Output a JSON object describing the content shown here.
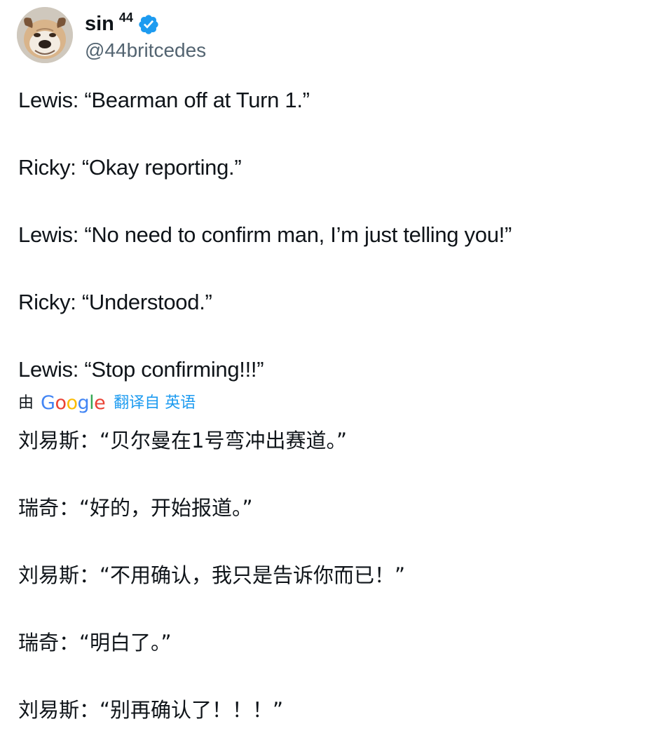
{
  "author": {
    "display_name": "sin",
    "name_superscript": "44",
    "handle": "@44britcedes",
    "verified": true,
    "verified_badge_color": "#1d9bf0",
    "avatar_icon": "bulldog-avatar-icon"
  },
  "tweet": {
    "paragraphs": [
      "Lewis: “Bearman off at Turn 1.”",
      "Ricky: “Okay reporting.”",
      "Lewis: “No need to confirm man, I’m just telling you!”",
      "Ricky: “Understood.”",
      "Lewis: “Stop confirming!!!”"
    ]
  },
  "translation": {
    "by_label": "由",
    "provider": "Google",
    "provider_letters": [
      "G",
      "o",
      "o",
      "g",
      "l",
      "e"
    ],
    "provider_colors": [
      "#4285f4",
      "#ea4335",
      "#fbbc05",
      "#4285f4",
      "#34a853",
      "#ea4335"
    ],
    "link_label": "翻译自 英语",
    "link_color": "#1d9bf0",
    "paragraphs": [
      "刘易斯：“贝尔曼在1号弯冲出赛道。”",
      "瑞奇：“好的，开始报道。”",
      "刘易斯：“不用确认，我只是告诉你而已！”",
      "瑞奇：“明白了。”",
      "刘易斯：“别再确认了！！！”"
    ]
  }
}
